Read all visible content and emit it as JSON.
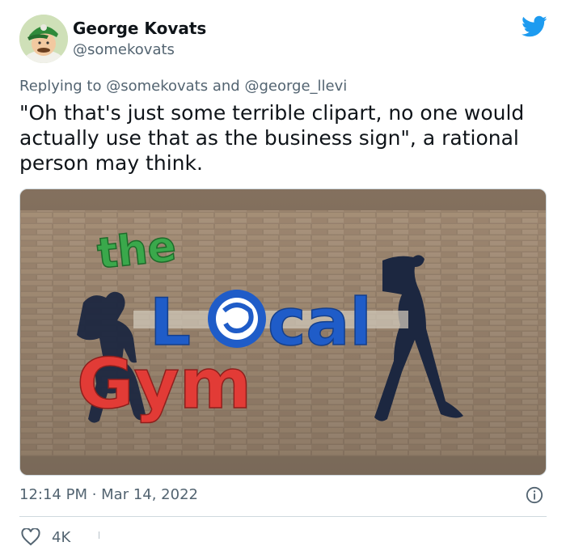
{
  "author": {
    "display_name": "George Kovats",
    "handle": "@somekovats"
  },
  "reply": {
    "prefix": "Replying to ",
    "mention_1": "@somekovats",
    "joiner": " and ",
    "mention_2": "@george_llevi"
  },
  "tweet": {
    "text": "\"Oh that's just some terrible clipart, no one would actually use that as the business sign\", a rational person may think."
  },
  "media": {
    "sign_word_1": "the",
    "sign_word_2_start": "L",
    "sign_word_2_end": "cal",
    "sign_word_3": "Gym"
  },
  "meta": {
    "timestamp": "12:14 PM · Mar 14, 2022"
  },
  "actions": {
    "like_count": "4K"
  },
  "icons": {
    "brand": "twitter-bird-icon",
    "like": "heart-icon",
    "info": "info-icon"
  },
  "colors": {
    "brand_blue": "#1d9bf0",
    "text_secondary": "#536471",
    "sign_green": "#3aa84b",
    "sign_blue": "#1f5cc8",
    "sign_red": "#e23b36"
  }
}
